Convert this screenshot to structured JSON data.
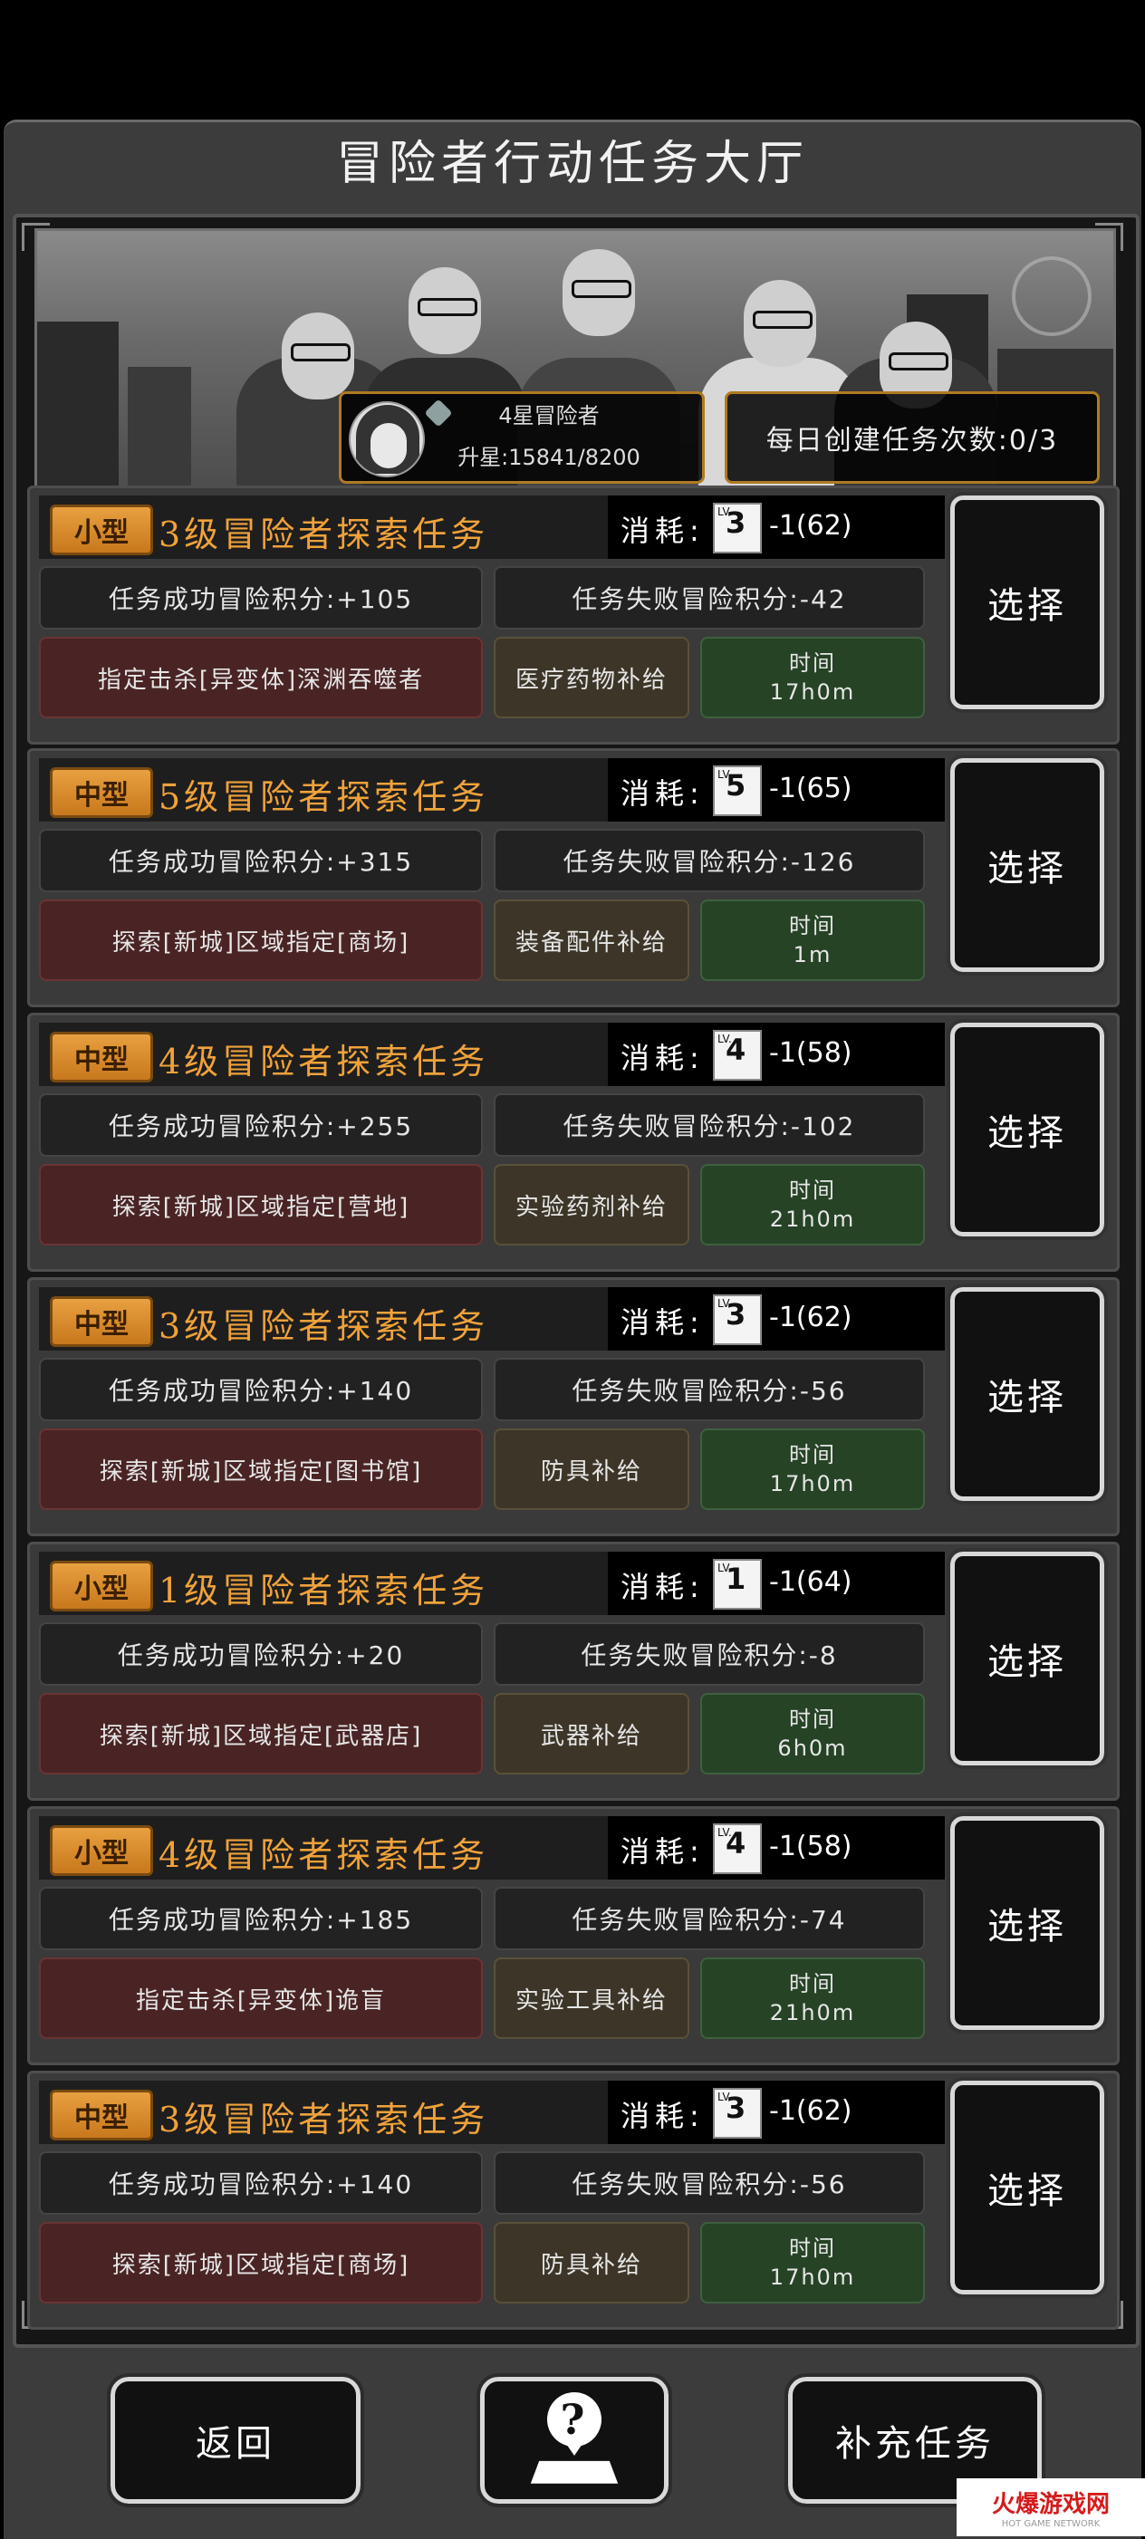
{
  "header": {
    "title": "冒险者行动任务大厅"
  },
  "rank": {
    "label": "4星冒险者",
    "progress": "升星:15841/8200"
  },
  "daily": {
    "text": "每日创建任务次数:0/3"
  },
  "tasks": [
    {
      "size": "小型",
      "title": "3级冒险者探索任务",
      "cost_label": "消耗:",
      "lv_text": "LV.",
      "lv": "3",
      "cost": "-1(62)",
      "success": "任务成功冒险积分:+105",
      "fail": "任务失败冒险积分:-42",
      "target": "指定击杀[异变体]深渊吞噬者",
      "reward": "医疗药物补给",
      "time_label": "时间",
      "time": "17h0m",
      "select": "选择"
    },
    {
      "size": "中型",
      "title": "5级冒险者探索任务",
      "cost_label": "消耗:",
      "lv_text": "LV.",
      "lv": "5",
      "cost": "-1(65)",
      "success": "任务成功冒险积分:+315",
      "fail": "任务失败冒险积分:-126",
      "target": "探索[新城]区域指定[商场]",
      "reward": "装备配件补给",
      "time_label": "时间",
      "time": "1m",
      "select": "选择"
    },
    {
      "size": "中型",
      "title": "4级冒险者探索任务",
      "cost_label": "消耗:",
      "lv_text": "LV.",
      "lv": "4",
      "cost": "-1(58)",
      "success": "任务成功冒险积分:+255",
      "fail": "任务失败冒险积分:-102",
      "target": "探索[新城]区域指定[营地]",
      "reward": "实验药剂补给",
      "time_label": "时间",
      "time": "21h0m",
      "select": "选择"
    },
    {
      "size": "中型",
      "title": "3级冒险者探索任务",
      "cost_label": "消耗:",
      "lv_text": "LV.",
      "lv": "3",
      "cost": "-1(62)",
      "success": "任务成功冒险积分:+140",
      "fail": "任务失败冒险积分:-56",
      "target": "探索[新城]区域指定[图书馆]",
      "reward": "防具补给",
      "time_label": "时间",
      "time": "17h0m",
      "select": "选择"
    },
    {
      "size": "小型",
      "title": "1级冒险者探索任务",
      "cost_label": "消耗:",
      "lv_text": "LV.",
      "lv": "1",
      "cost": "-1(64)",
      "success": "任务成功冒险积分:+20",
      "fail": "任务失败冒险积分:-8",
      "target": "探索[新城]区域指定[武器店]",
      "reward": "武器补给",
      "time_label": "时间",
      "time": "6h0m",
      "select": "选择"
    },
    {
      "size": "小型",
      "title": "4级冒险者探索任务",
      "cost_label": "消耗:",
      "lv_text": "LV.",
      "lv": "4",
      "cost": "-1(58)",
      "success": "任务成功冒险积分:+185",
      "fail": "任务失败冒险积分:-74",
      "target": "指定击杀[异变体]诡盲",
      "reward": "实验工具补给",
      "time_label": "时间",
      "time": "21h0m",
      "select": "选择"
    },
    {
      "size": "中型",
      "title": "3级冒险者探索任务",
      "cost_label": "消耗:",
      "lv_text": "LV.",
      "lv": "3",
      "cost": "-1(62)",
      "success": "任务成功冒险积分:+140",
      "fail": "任务失败冒险积分:-56",
      "target": "探索[新城]区域指定[商场]",
      "reward": "防具补给",
      "time_label": "时间",
      "time": "17h0m",
      "select": "选择"
    }
  ],
  "footer": {
    "back": "返回",
    "help_icon": "question-map-icon",
    "supplement": "补充任务"
  },
  "watermark": {
    "main": "火爆游戏网",
    "sub": "HOT GAME NETWORK"
  },
  "colors": {
    "accent": "#f0a23a",
    "badge": "#d88c2c",
    "target": "#4a2424",
    "reward": "#3d3628",
    "time": "#264326"
  }
}
